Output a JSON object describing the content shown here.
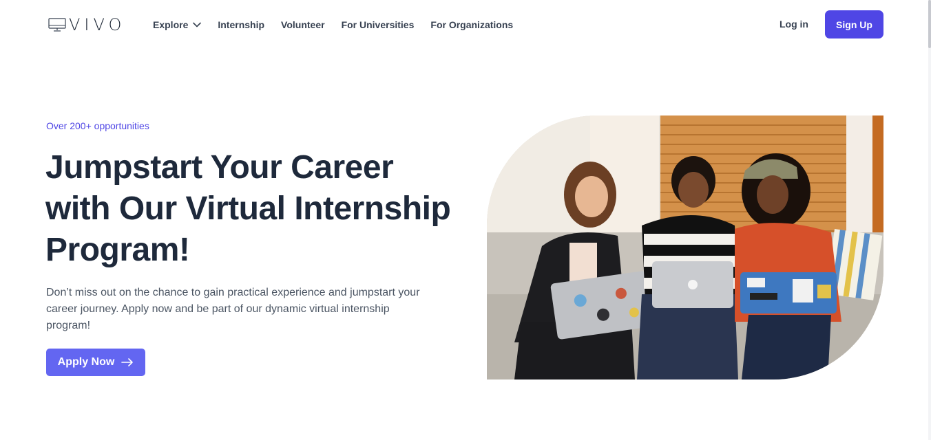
{
  "brand": {
    "name": "VIVO",
    "logo_icon": "monitor-icon"
  },
  "nav": {
    "items": [
      {
        "label": "Explore",
        "has_dropdown": true
      },
      {
        "label": "Internship"
      },
      {
        "label": "Volunteer"
      },
      {
        "label": "For Universities"
      },
      {
        "label": "For Organizations"
      }
    ],
    "login_label": "Log in",
    "signup_label": "Sign Up"
  },
  "hero": {
    "eyebrow": "Over 200+ opportunities",
    "headline": "Jumpstart Your Career with Our Virtual Internship Program!",
    "subtext": "Don’t miss out on the chance to gain practical experience and jumpstart your career journey. Apply now and be part of our dynamic virtual internship program!",
    "cta_label": "Apply Now",
    "cta_icon": "arrow-right-icon",
    "image_subject": "three women working on laptops on a couch"
  },
  "colors": {
    "accent": "#4f46e5",
    "cta": "#6366f1",
    "heading": "#1e293b",
    "body": "#4b5563"
  }
}
